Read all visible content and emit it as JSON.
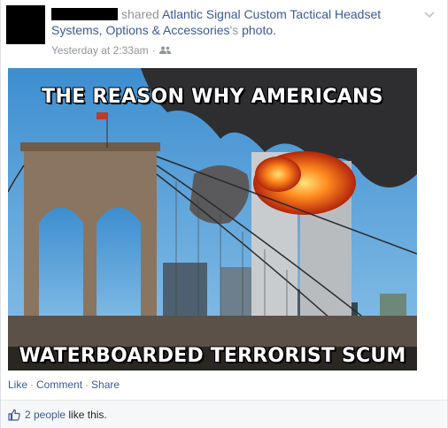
{
  "post": {
    "action_text": "shared",
    "page_name": "Atlantic Signal Custom Tactical Headset Systems, Options & Accessories",
    "possessive": "'s",
    "object_text": "photo.",
    "timestamp": "Yesterday at 2:33am",
    "separator": "·",
    "audience_icon": "friends-icon",
    "menu_icon": "chevron-down-icon"
  },
  "photo": {
    "top_caption": "THE REASON WHY AMERICANS",
    "bottom_caption": "WATERBOARDED TERRORIST SCUM"
  },
  "actions": {
    "like": "Like",
    "comment": "Comment",
    "share": "Share",
    "separator": "·"
  },
  "likes": {
    "icon": "thumbs-up-icon",
    "count_text": "2 people",
    "suffix": "like this."
  },
  "colors": {
    "link": "#3b5998",
    "muted": "#90949c",
    "sky": "#5fa4d6",
    "smoke": "#2b2b2b",
    "fire": "#f05a1a"
  }
}
